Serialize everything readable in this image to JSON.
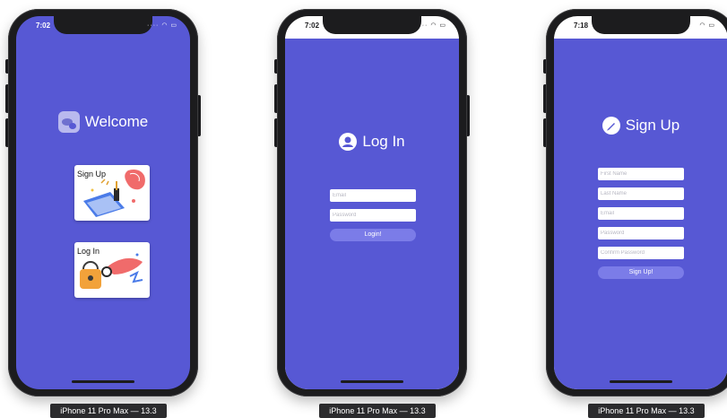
{
  "devices": [
    {
      "time": "7:02",
      "caption": "iPhone 11 Pro Max — 13.3",
      "title": "Welcome",
      "cards": [
        {
          "label": "Sign Up",
          "illustration": "signup-illustration"
        },
        {
          "label": "Log In",
          "illustration": "login-illustration"
        }
      ]
    },
    {
      "time": "7:02",
      "caption": "iPhone 11 Pro Max — 13.3",
      "title": "Log In",
      "icon": "user-icon",
      "fields": [
        {
          "placeholder": "Email"
        },
        {
          "placeholder": "Password"
        }
      ],
      "button": "Login!"
    },
    {
      "time": "7:18",
      "caption": "iPhone 11 Pro Max — 13.3",
      "title": "Sign Up",
      "icon": "pencil-icon",
      "fields": [
        {
          "placeholder": "First Name"
        },
        {
          "placeholder": "Last Name"
        },
        {
          "placeholder": "Email"
        },
        {
          "placeholder": "Password"
        },
        {
          "placeholder": "Confirm Password"
        }
      ],
      "button": "Sign Up!"
    }
  ],
  "colors": {
    "screen_bg": "#5758d4",
    "button_bg": "#7b7ce8",
    "frame": "#1c1c1e"
  }
}
